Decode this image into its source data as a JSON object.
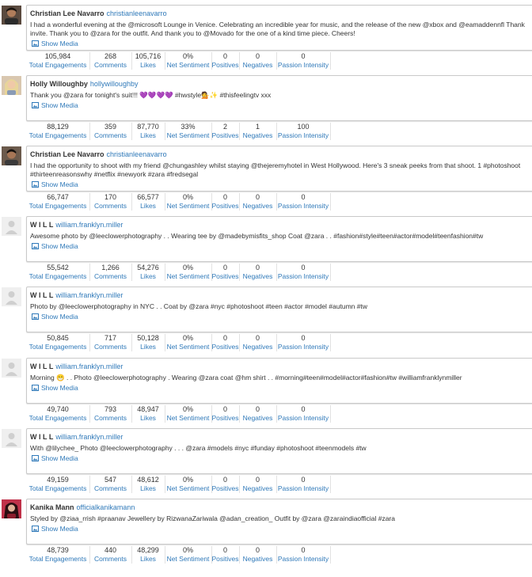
{
  "media_label": "Show Media",
  "stat_labels": [
    "Total Engagements",
    "Comments",
    "Likes",
    "Net Sentiment",
    "Positives",
    "Negatives",
    "Passion Intensity"
  ],
  "colors": {
    "link": "#2f79b9",
    "text": "#333333",
    "border": "#c9c9c9"
  },
  "posts": [
    {
      "author": "Christian Lee Navarro",
      "handle": "christianleenavarro",
      "avatar_icon": "person-photo-icon",
      "lines": [
        "I had a wonderful evening at the @microsoft Lounge in Venice. Celebrating an incredible year for music, and the release of the new @xbox and @eamaddennfl Thank",
        "invite. Thank you to @zara for the outfit. And thank you to @Movado for the one of a kind time piece. Cheers!"
      ],
      "stats": [
        "105,984",
        "268",
        "105,716",
        "0%",
        "0",
        "0",
        "0"
      ]
    },
    {
      "author": "Holly Willoughby",
      "handle": "hollywilloughby",
      "avatar_icon": "person-photo-icon",
      "lines": [
        "Thank you @zara for tonight's suit!!! 💜💜💜💜 #hwstyle💁✨ #thisfeelingtv xxx"
      ],
      "stats": [
        "88,129",
        "359",
        "87,770",
        "33%",
        "2",
        "1",
        "100"
      ]
    },
    {
      "author": "Christian Lee Navarro",
      "handle": "christianleenavarro",
      "avatar_icon": "person-photo-icon",
      "lines": [
        "I had the opportunity to shoot with my friend @chungashley whilst staying @thejeremyhotel in West Hollywood. Here's 3 sneak peeks from that shoot. 1 #photoshoot",
        "#thirteenreasonswhy #netflix #newyork #zara #fredsegal"
      ],
      "stats": [
        "66,747",
        "170",
        "66,577",
        "0%",
        "0",
        "0",
        "0"
      ]
    },
    {
      "author": "W I L L",
      "handle": "william.franklyn.miller",
      "avatar_icon": "default-avatar-icon",
      "lines": [
        "Awesome photo by @leeclowerphotography . . Wearing tee by @madebymisfits_shop Coat @zara . . #fashion#style#teen#actor#model#teenfashion#tw"
      ],
      "stats": [
        "55,542",
        "1,266",
        "54,276",
        "0%",
        "0",
        "0",
        "0"
      ]
    },
    {
      "author": "W I L L",
      "handle": "william.franklyn.miller",
      "avatar_icon": "default-avatar-icon",
      "lines": [
        "Photo by @leeclowerphotography in NYC . . Coat by @zara #nyc #photoshoot #teen #actor #model #autumn #tw"
      ],
      "stats": [
        "50,845",
        "717",
        "50,128",
        "0%",
        "0",
        "0",
        "0"
      ]
    },
    {
      "author": "W I L L",
      "handle": "william.franklyn.miller",
      "avatar_icon": "default-avatar-icon",
      "lines": [
        "Morning 😁 . . Photo @leeclowerphotography . Wearing @zara coat @hm shirt . . #morning#teen#model#actor#fashion#tw #williamfranklynmiller"
      ],
      "stats": [
        "49,740",
        "793",
        "48,947",
        "0%",
        "0",
        "0",
        "0"
      ]
    },
    {
      "author": "W I L L",
      "handle": "william.franklyn.miller",
      "avatar_icon": "default-avatar-icon",
      "lines": [
        "With @lilychee_ Photo @leeclowerphotography . . . @zara #models #nyc #funday #photoshoot #teenmodels #tw"
      ],
      "stats": [
        "49,159",
        "547",
        "48,612",
        "0%",
        "0",
        "0",
        "0"
      ]
    },
    {
      "author": "Kanika Mann",
      "handle": "officialkanikamann",
      "avatar_icon": "person-photo-icon",
      "lines": [
        "Styled by @ziaa_rrish #praanav Jewellery by RizwanaZariwala @adan_creation_ Outfit by @zara @zaraindiaofficial #zara"
      ],
      "stats": [
        "48,739",
        "440",
        "48,299",
        "0%",
        "0",
        "0",
        "0"
      ]
    }
  ]
}
